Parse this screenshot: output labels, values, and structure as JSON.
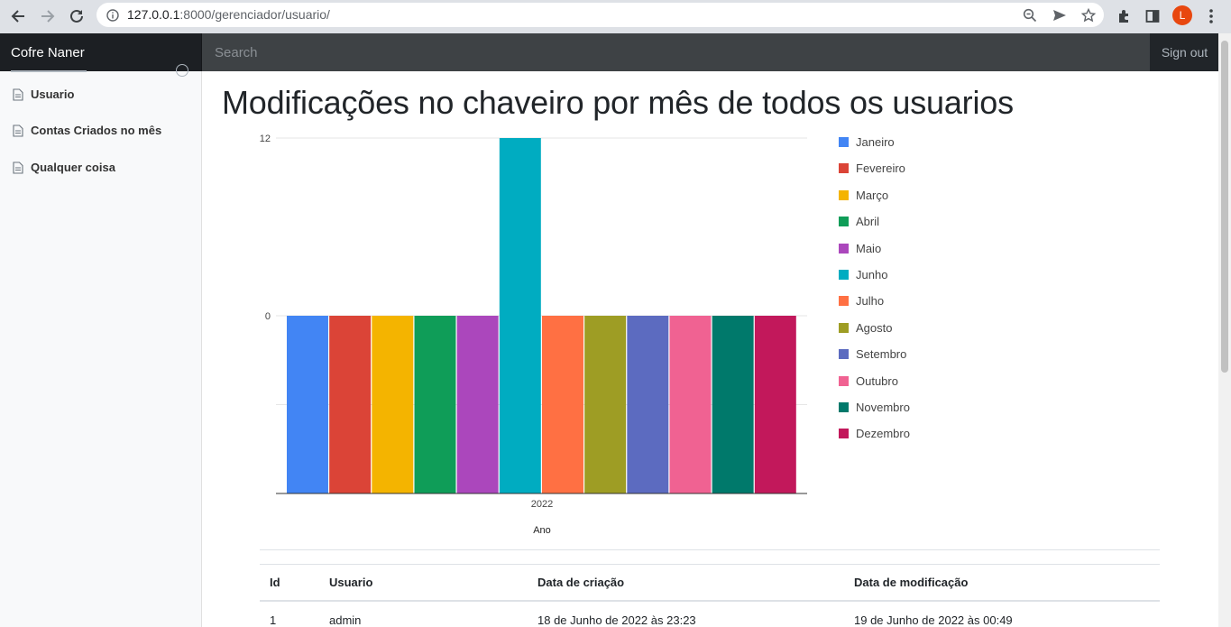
{
  "browser": {
    "url_host": "127.0.0.1",
    "url_rest": ":8000/gerenciador/usuario/",
    "avatar_letter": "L"
  },
  "navbar": {
    "brand": "Cofre Naner",
    "search_placeholder": "Search",
    "signout": "Sign out"
  },
  "sidebar": {
    "items": [
      {
        "label": "Usuario",
        "icon": "file-icon"
      },
      {
        "label": "Contas Criados no mês",
        "icon": "file-icon"
      },
      {
        "label": "Qualquer coisa",
        "icon": "file-icon"
      }
    ]
  },
  "main": {
    "title": "Modificações no chaveiro por mês de todos os usuarios"
  },
  "chart_data": {
    "type": "bar",
    "categories": [
      "2022"
    ],
    "xlabel": "Ano",
    "ylabel": "",
    "ylim": [
      -12,
      12
    ],
    "y_tick_labels": [
      "12",
      "0"
    ],
    "legend_position": "right",
    "series": [
      {
        "name": "Janeiro",
        "values": [
          0
        ],
        "color": "#4285f4"
      },
      {
        "name": "Fevereiro",
        "values": [
          0
        ],
        "color": "#db4437"
      },
      {
        "name": "Março",
        "values": [
          0
        ],
        "color": "#f4b400"
      },
      {
        "name": "Abril",
        "values": [
          0
        ],
        "color": "#0f9d58"
      },
      {
        "name": "Maio",
        "values": [
          0
        ],
        "color": "#ab47bc"
      },
      {
        "name": "Junho",
        "values": [
          12
        ],
        "color": "#00acc1"
      },
      {
        "name": "Julho",
        "values": [
          0
        ],
        "color": "#ff7043"
      },
      {
        "name": "Agosto",
        "values": [
          0
        ],
        "color": "#9e9d24"
      },
      {
        "name": "Setembro",
        "values": [
          0
        ],
        "color": "#5c6bc0"
      },
      {
        "name": "Outubro",
        "values": [
          0
        ],
        "color": "#f06292"
      },
      {
        "name": "Novembro",
        "values": [
          0
        ],
        "color": "#00796b"
      },
      {
        "name": "Dezembro",
        "values": [
          0
        ],
        "color": "#c2185b"
      }
    ]
  },
  "table": {
    "headers": [
      "Id",
      "Usuario",
      "Data de criação",
      "Data de modificação"
    ],
    "rows": [
      [
        "1",
        "admin",
        "18 de Junho de 2022 às 23:23",
        "19 de Junho de 2022 às 00:49"
      ]
    ]
  }
}
